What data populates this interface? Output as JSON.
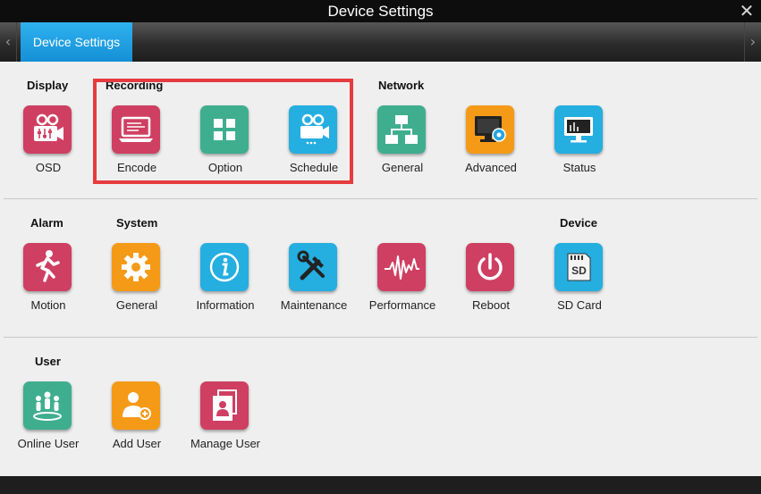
{
  "window": {
    "title": "Device Settings",
    "close_glyph": "✕"
  },
  "nav": {
    "left_arrow": "‹",
    "right_arrow": "›",
    "tab_label": "Device Settings"
  },
  "row1": {
    "display_label": "Display",
    "recording_label": "Recording",
    "network_label": "Network",
    "osd": "OSD",
    "encode": "Encode",
    "option": "Option",
    "schedule": "Schedule",
    "network_general": "General",
    "advanced": "Advanced",
    "status": "Status"
  },
  "row2": {
    "alarm_label": "Alarm",
    "system_label": "System",
    "device_label": "Device",
    "motion": "Motion",
    "system_general": "General",
    "information": "Information",
    "maintenance": "Maintenance",
    "performance": "Performance",
    "reboot": "Reboot",
    "sd_card": "SD Card",
    "sd_text": "SD"
  },
  "row3": {
    "user_label": "User",
    "online_user": "Online User",
    "add_user": "Add User",
    "manage_user": "Manage User"
  },
  "icons": {
    "osd": "video-camera-sliders-icon",
    "encode": "laptop-icon",
    "option": "grid-icon",
    "schedule": "camera-icon",
    "network_general": "network-icon",
    "advanced": "monitor-gear-icon",
    "status": "monitor-status-icon",
    "motion": "running-person-icon",
    "system_general": "gear-icon",
    "information": "info-icon",
    "maintenance": "tools-icon",
    "performance": "waveform-icon",
    "reboot": "power-icon",
    "sd_card": "sd-card-icon",
    "online_user": "users-icon",
    "add_user": "add-user-icon",
    "manage_user": "manage-user-icon"
  },
  "colors": {
    "red": "#cf3f62",
    "green": "#3fae8f",
    "blue": "#25aee0",
    "orange": "#f59a17",
    "tab": "#1ea4e6",
    "highlight": "#e63b3f"
  }
}
